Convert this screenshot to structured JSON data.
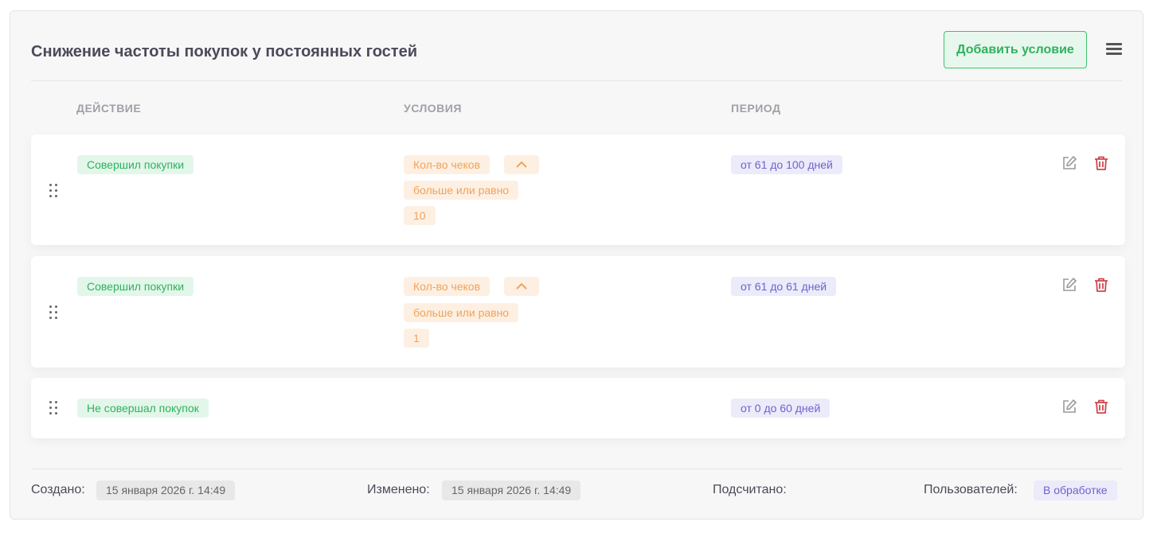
{
  "header": {
    "title": "Снижение частоты покупок у постоянных гостей",
    "add_button": "Добавить условие",
    "menu_icon": "hamburger-menu-icon"
  },
  "columns": {
    "action": "ДЕЙСТВИЕ",
    "conditions": "УСЛОВИЯ",
    "period": "ПЕРИОД"
  },
  "rows": [
    {
      "action": "Совершил покупки",
      "condition_field": "Кол-во чеков",
      "condition_operator": "больше или равно",
      "condition_value": "10",
      "period": "от 61 до 100 дней"
    },
    {
      "action": "Совершил покупки",
      "condition_field": "Кол-во чеков",
      "condition_operator": "больше или равно",
      "condition_value": "1",
      "period": "от 61 до 61 дней"
    },
    {
      "action": "Не совершал покупок",
      "period": "от 0 до 60 дней"
    }
  ],
  "footer": {
    "created_label": "Создано:",
    "created_value": "15 января 2026 г. 14:49",
    "modified_label": "Изменено:",
    "modified_value": "15 января 2026 г. 14:49",
    "counted_label": "Подсчитано:",
    "users_label": "Пользователей:",
    "users_status": "В обработке"
  },
  "colors": {
    "green": "#2fb25c",
    "orange": "#f1a25a",
    "purple": "#6b63cf",
    "delete": "#d0454c"
  }
}
